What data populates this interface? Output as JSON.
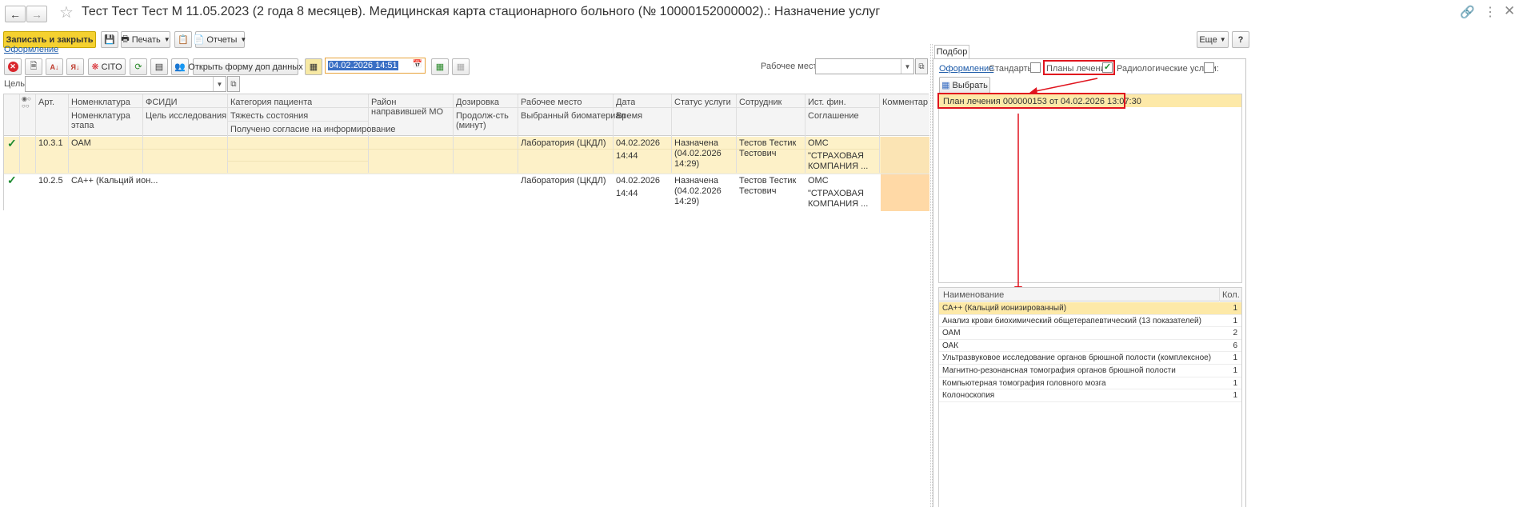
{
  "window": {
    "title": "Тест Тест Тест М 11.05.2023 (2 года 8 месяцев). Медицинская карта стационарного больного (№ 10000152000002).: Назначение услуг"
  },
  "toolbar": {
    "save_close": "Записать и закрыть",
    "print": "Печать",
    "reports": "Отчеты",
    "more": "Еще",
    "help": "?"
  },
  "left": {
    "design_link": "Оформление",
    "cito": "CITO",
    "open_form": "Открыть форму доп данных",
    "date_value": "04.02.2026 14:51",
    "workplace_label": "Рабочее место:",
    "workplace_value": "",
    "goal_label": "Цель:",
    "goal_value": ""
  },
  "grid": {
    "headers": {
      "art": "Арт.",
      "nomenclature": "Номенклатура",
      "nomenclature_stage": "Номенклатура этапа",
      "fsidi": "ФСИДИ",
      "research_goal": "Цель исследования",
      "patient_category": "Категория пациента",
      "severity": "Тяжесть состояния",
      "consent": "Получено согласие на информирование",
      "district": "Район направившей МО",
      "dosage": "Дозировка",
      "duration": "Продолж-сть (минут)",
      "workplace": "Рабочее место",
      "biomaterial": "Выбранный биоматериал",
      "date": "Дата",
      "time": "Время",
      "status": "Статус услуги",
      "employee": "Сотрудник",
      "fin_source": "Ист. фин.",
      "agreement": "Соглашение",
      "comment": "Комментарий"
    },
    "rows": [
      {
        "art": "10.3.1",
        "nomenclature": "ОАМ",
        "workplace": "Лаборатория (ЦКДЛ)",
        "date": "04.02.2026",
        "time": "14:44",
        "status": "Назначена (04.02.2026 14:29)",
        "employee": "Тестов Тестик Тестович",
        "fin_source": "ОМС",
        "agreement": "\"СТРАХОВАЯ КОМПАНИЯ ..."
      },
      {
        "art": "10.2.5",
        "nomenclature": "СА++ (Кальций ион...",
        "workplace": "Лаборатория (ЦКДЛ)",
        "date": "04.02.2026",
        "time": "14:44",
        "status": "Назначена (04.02.2026 14:29)",
        "employee": "Тестов Тестик Тестович",
        "fin_source": "ОМС",
        "agreement": "\"СТРАХОВАЯ КОМПАНИЯ ..."
      }
    ]
  },
  "right": {
    "tab": "Подбор",
    "design_link": "Оформление",
    "standards_label": "Стандарты:",
    "standards_checked": false,
    "plans_label": "Планы лечения:",
    "plans_checked": true,
    "radiology_label": "Радиологические услуги:",
    "radiology_checked": false,
    "select_button": "Выбрать",
    "plan_item": "План лечения 000000153 от 04.02.2026 13:07:30",
    "list_headers": {
      "name": "Наименование",
      "qty": "Кол."
    },
    "list": [
      {
        "name": "СА++ (Кальций ионизированный)",
        "qty": "1"
      },
      {
        "name": "Анализ крови биохимический общетерапевтический (13 показателей)",
        "qty": "1"
      },
      {
        "name": "ОАМ",
        "qty": "2"
      },
      {
        "name": "ОАК",
        "qty": "6"
      },
      {
        "name": "Ультразвуковое исследование органов брюшной полости (комплексное)",
        "qty": "1"
      },
      {
        "name": "Магнитно-резонансная томография органов брюшной полости",
        "qty": "1"
      },
      {
        "name": "Компьютерная томография головного мозга",
        "qty": "1"
      },
      {
        "name": "Колоноскопия",
        "qty": "1"
      }
    ]
  },
  "colors": {
    "accent_yellow": "#f5d130",
    "selected_row": "#fdf1c8",
    "highlight": "#ffe18a",
    "annotation_red": "#e0141e",
    "check_green": "#1c8a2e"
  }
}
